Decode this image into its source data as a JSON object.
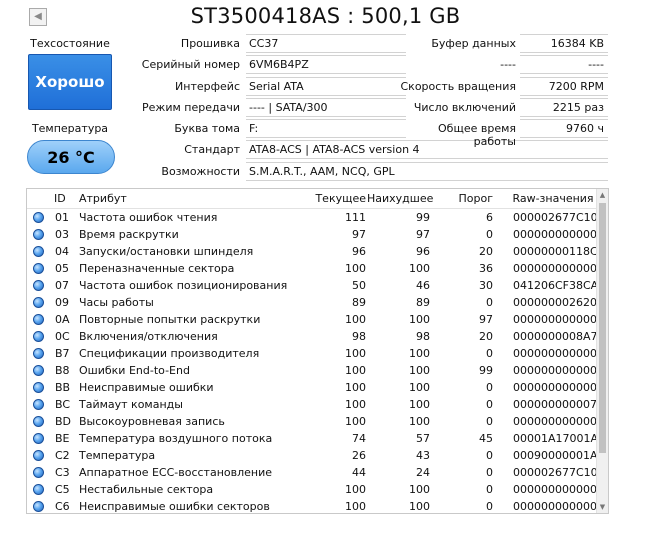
{
  "title": "ST3500418AS : 500,1 GB",
  "left": {
    "health_label": "Техсостояние",
    "health_value": "Хорошо",
    "temp_label": "Температура",
    "temp_value": "26 °C"
  },
  "fields": {
    "firmware": {
      "label": "Прошивка",
      "value": "CC37"
    },
    "serial": {
      "label": "Серийный номер",
      "value": "6VM6B4PZ"
    },
    "interface": {
      "label": "Интерфейс",
      "value": "Serial ATA"
    },
    "transfer": {
      "label": "Режим передачи",
      "value": "---- | SATA/300"
    },
    "drive_letter": {
      "label": "Буква тома",
      "value": "F:"
    },
    "standard": {
      "label": "Стандарт",
      "value": "ATA8-ACS | ATA8-ACS version 4"
    },
    "features": {
      "label": "Возможности",
      "value": "S.M.A.R.T., AAM, NCQ, GPL"
    },
    "buffer": {
      "label": "Буфер данных",
      "value": "16384 KB"
    },
    "unknown1": {
      "label": "----",
      "value": "----"
    },
    "rotation": {
      "label": "Скорость вращения",
      "value": "7200 RPM"
    },
    "power_count": {
      "label": "Число включений",
      "value": "2215 раз"
    },
    "power_hours": {
      "label": "Общее время работы",
      "value": "9760 ч"
    }
  },
  "table": {
    "headers": [
      "ID",
      "Атрибут",
      "Текущее",
      "Наихудшее",
      "Порог",
      "Raw-значения"
    ],
    "rows": [
      {
        "id": "01",
        "name": "Частота ошибок чтения",
        "cur": "111",
        "worst": "99",
        "thr": "6",
        "raw": "000002677C10"
      },
      {
        "id": "03",
        "name": "Время раскрутки",
        "cur": "97",
        "worst": "97",
        "thr": "0",
        "raw": "000000000000"
      },
      {
        "id": "04",
        "name": "Запуски/остановки шпинделя",
        "cur": "96",
        "worst": "96",
        "thr": "20",
        "raw": "00000000118C"
      },
      {
        "id": "05",
        "name": "Переназначенные сектора",
        "cur": "100",
        "worst": "100",
        "thr": "36",
        "raw": "000000000000"
      },
      {
        "id": "07",
        "name": "Частота ошибок позиционирования",
        "cur": "50",
        "worst": "46",
        "thr": "30",
        "raw": "041206CF38CA"
      },
      {
        "id": "09",
        "name": "Часы работы",
        "cur": "89",
        "worst": "89",
        "thr": "0",
        "raw": "000000002620"
      },
      {
        "id": "0A",
        "name": "Повторные попытки раскрутки",
        "cur": "100",
        "worst": "100",
        "thr": "97",
        "raw": "000000000000"
      },
      {
        "id": "0C",
        "name": "Включения/отключения",
        "cur": "98",
        "worst": "98",
        "thr": "20",
        "raw": "0000000008A7"
      },
      {
        "id": "B7",
        "name": "Спецификации производителя",
        "cur": "100",
        "worst": "100",
        "thr": "0",
        "raw": "000000000000"
      },
      {
        "id": "B8",
        "name": "Ошибки End-to-End",
        "cur": "100",
        "worst": "100",
        "thr": "99",
        "raw": "000000000000"
      },
      {
        "id": "BB",
        "name": "Неисправимые ошибки",
        "cur": "100",
        "worst": "100",
        "thr": "0",
        "raw": "000000000000"
      },
      {
        "id": "BC",
        "name": "Таймаут команды",
        "cur": "100",
        "worst": "100",
        "thr": "0",
        "raw": "000000000007"
      },
      {
        "id": "BD",
        "name": "Высокоуровневая запись",
        "cur": "100",
        "worst": "100",
        "thr": "0",
        "raw": "000000000000"
      },
      {
        "id": "BE",
        "name": "Температура воздушного потока",
        "cur": "74",
        "worst": "57",
        "thr": "45",
        "raw": "00001A17001A"
      },
      {
        "id": "C2",
        "name": "Температура",
        "cur": "26",
        "worst": "43",
        "thr": "0",
        "raw": "00090000001A"
      },
      {
        "id": "C3",
        "name": "Аппаратное ECC-восстановление",
        "cur": "44",
        "worst": "24",
        "thr": "0",
        "raw": "000002677C10"
      },
      {
        "id": "C5",
        "name": "Нестабильные сектора",
        "cur": "100",
        "worst": "100",
        "thr": "0",
        "raw": "000000000000"
      },
      {
        "id": "C6",
        "name": "Неисправимые ошибки секторов",
        "cur": "100",
        "worst": "100",
        "thr": "0",
        "raw": "000000000000"
      }
    ]
  },
  "colors": {
    "health_bg": "#2479e0",
    "temp_bg": "#7dbcf4",
    "status_dot": "#3b8de8"
  },
  "icons": {
    "nav": "left-arrow-icon",
    "status": "status-dot-icon"
  }
}
